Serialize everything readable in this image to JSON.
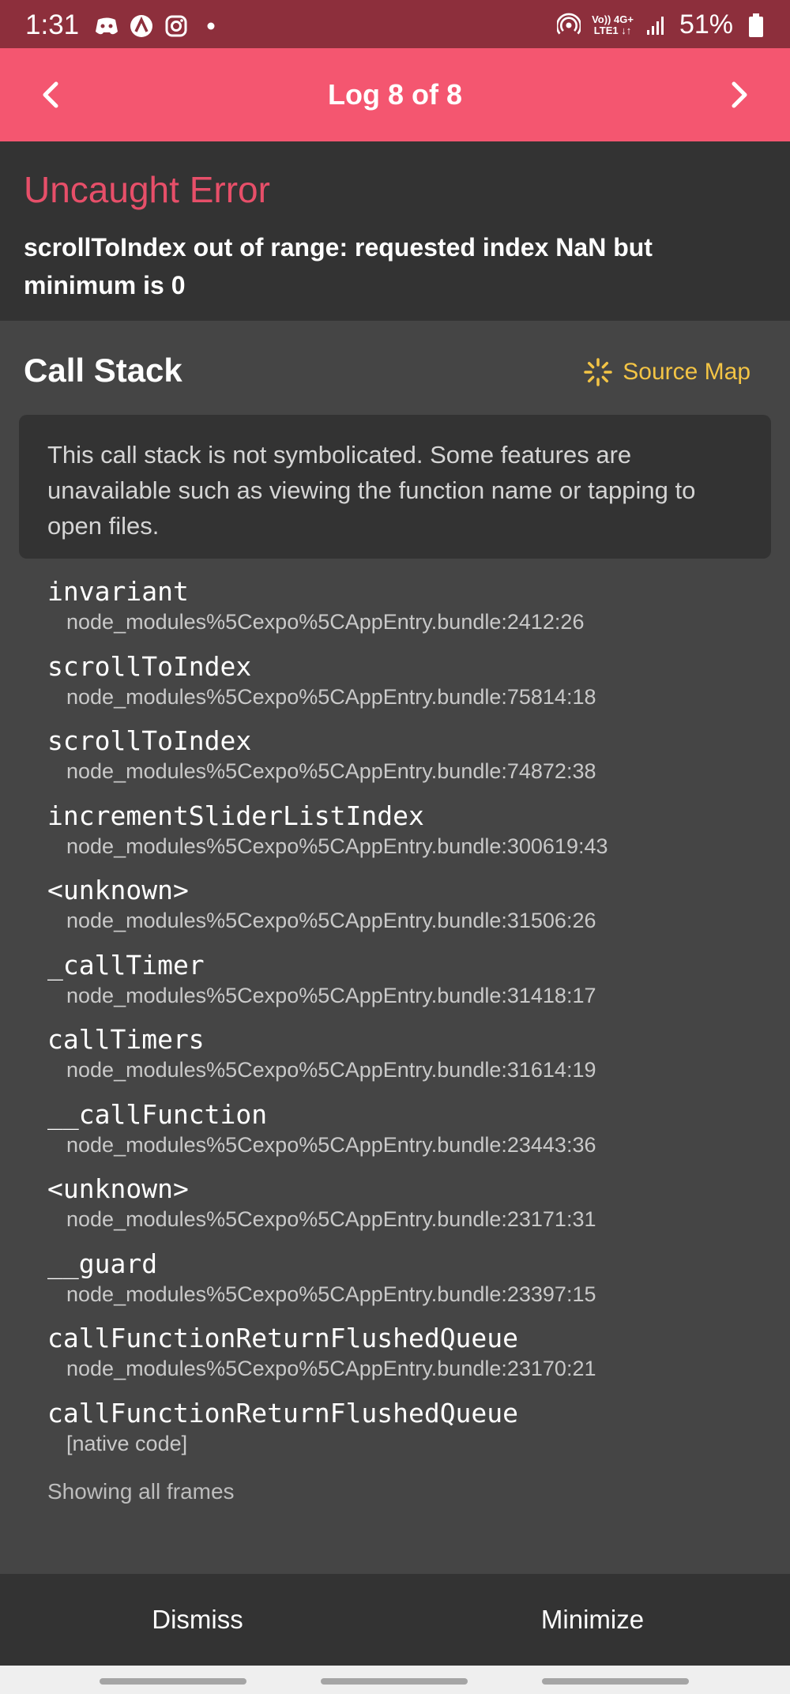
{
  "status_bar": {
    "time": "1:31",
    "left_icons": [
      "discord-icon",
      "app-icon",
      "instagram-icon",
      "dot-icon"
    ],
    "network_top": "Vo)) 4G+",
    "network_bottom": "LTE1 ↓↑",
    "battery": "51%"
  },
  "header": {
    "title": "Log 8 of 8",
    "prev_icon": "chevron-left-icon",
    "next_icon": "chevron-right-icon",
    "background": "#f45670"
  },
  "error": {
    "title": "Uncaught Error",
    "message": "scrollToIndex out of range: requested index NaN but minimum is 0",
    "title_color": "#e74f69"
  },
  "call_stack": {
    "title": "Call Stack",
    "source_map_label": "Source Map",
    "source_map_icon": "loading-spinner-icon",
    "notice": "This call stack is not symbolicated. Some features are unavailable such as viewing the function name or tapping to open files.",
    "frames": [
      {
        "name": "invariant",
        "location": "node_modules%5Cexpo%5CAppEntry.bundle:2412:26"
      },
      {
        "name": "scrollToIndex",
        "location": "node_modules%5Cexpo%5CAppEntry.bundle:75814:18"
      },
      {
        "name": "scrollToIndex",
        "location": "node_modules%5Cexpo%5CAppEntry.bundle:74872:38"
      },
      {
        "name": "incrementSliderListIndex",
        "location": "node_modules%5Cexpo%5CAppEntry.bundle:300619:43"
      },
      {
        "name": "<unknown>",
        "location": "node_modules%5Cexpo%5CAppEntry.bundle:31506:26"
      },
      {
        "name": "_callTimer",
        "location": "node_modules%5Cexpo%5CAppEntry.bundle:31418:17"
      },
      {
        "name": "callTimers",
        "location": "node_modules%5Cexpo%5CAppEntry.bundle:31614:19"
      },
      {
        "name": "__callFunction",
        "location": "node_modules%5Cexpo%5CAppEntry.bundle:23443:36"
      },
      {
        "name": "<unknown>",
        "location": "node_modules%5Cexpo%5CAppEntry.bundle:23171:31"
      },
      {
        "name": "__guard",
        "location": "node_modules%5Cexpo%5CAppEntry.bundle:23397:15"
      },
      {
        "name": "callFunctionReturnFlushedQueue",
        "location": "node_modules%5Cexpo%5CAppEntry.bundle:23170:21"
      },
      {
        "name": "callFunctionReturnFlushedQueue",
        "location": "[native code]"
      }
    ],
    "frames_status": "Showing all frames"
  },
  "footer": {
    "dismiss_label": "Dismiss",
    "minimize_label": "Minimize"
  }
}
